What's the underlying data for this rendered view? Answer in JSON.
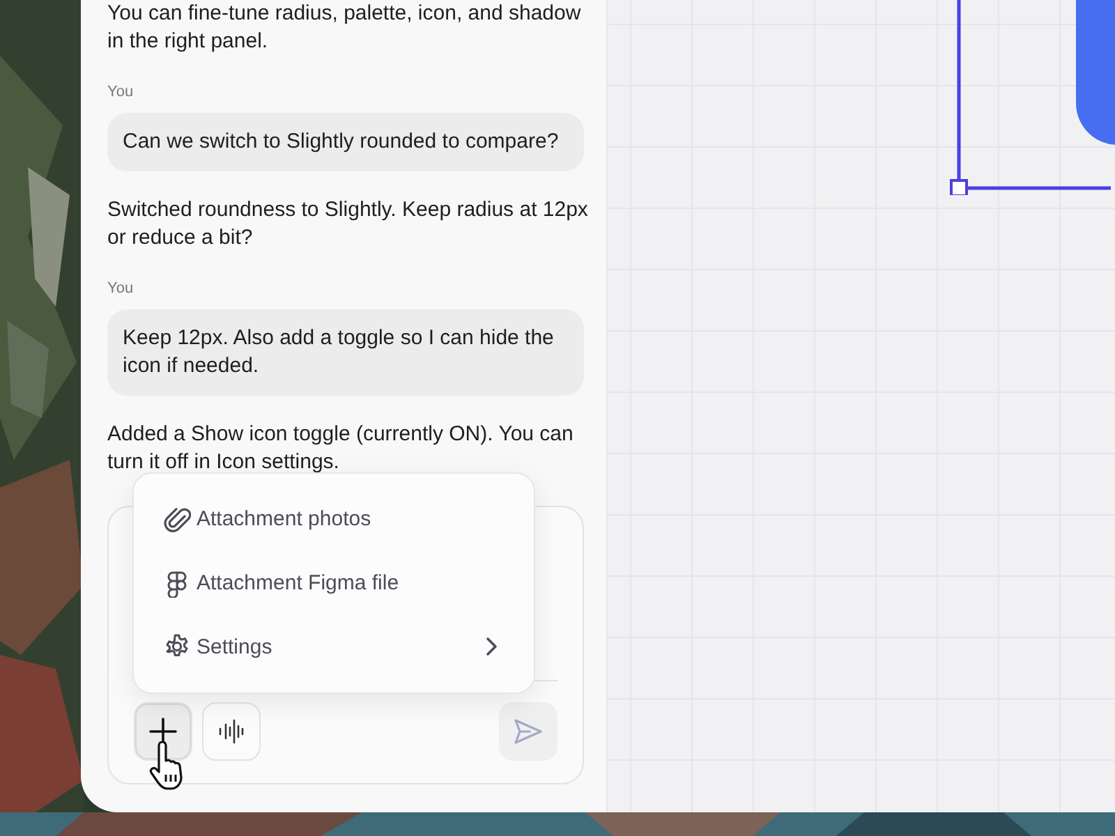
{
  "messages": [
    {
      "kind": "assistant",
      "text": "You can fine-tune radius, palette, icon, and shadow in the right panel."
    },
    {
      "kind": "user",
      "author": "You",
      "text": "Can we switch to Slightly rounded to compare?"
    },
    {
      "kind": "assistant",
      "text": "Switched roundness to Slightly. Keep radius at 12px or reduce a bit?"
    },
    {
      "kind": "user",
      "author": "You",
      "text": "Keep 12px. Also add a toggle so I can hide the icon if needed."
    },
    {
      "kind": "assistant",
      "text": "Added a Show icon toggle (currently ON). You can turn it off in Icon settings."
    }
  ],
  "composer": {
    "menu": {
      "open": true,
      "items": [
        {
          "kind": "attach",
          "label": "Attachment photos",
          "submenu": false
        },
        {
          "kind": "figma",
          "label": "Attachment Figma file",
          "submenu": false
        },
        {
          "kind": "settings",
          "label": "Settings",
          "submenu": true
        }
      ]
    },
    "buttons": [
      {
        "kind": "add",
        "selected": true,
        "disabled": false
      },
      {
        "kind": "voice",
        "selected": false,
        "disabled": false
      },
      {
        "kind": "send",
        "selected": false,
        "disabled": true
      }
    ]
  }
}
